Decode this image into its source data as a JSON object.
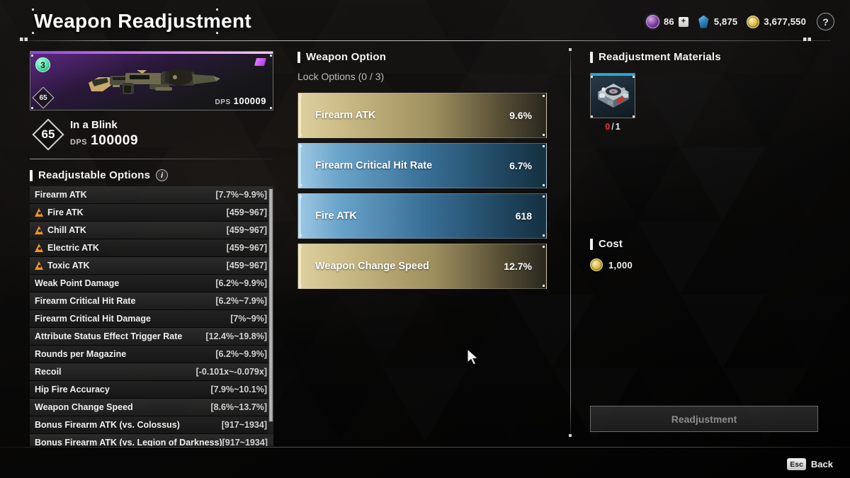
{
  "header": {
    "title": "Weapon Readjustment",
    "currencies": [
      {
        "icon": "orb-icon",
        "value": "86",
        "has_plus": true,
        "plus_label": "+"
      },
      {
        "icon": "gem-icon",
        "value": "5,875",
        "has_plus": false
      },
      {
        "icon": "gold-coin-icon",
        "value": "3,677,550",
        "has_plus": false
      }
    ],
    "help_label": "?"
  },
  "weapon": {
    "rank_badge": "3",
    "card_level": "65",
    "card_dps_label": "DPS",
    "card_dps_value": "100009",
    "level": "65",
    "name": "In a Blink",
    "dps_label": "DPS",
    "dps_value": "100009"
  },
  "readjustable": {
    "heading": "Readjustable Options",
    "info_label": "i",
    "rows": [
      {
        "name": "Firearm ATK",
        "range": "[7.7%~9.9%]",
        "warn": false
      },
      {
        "name": "Fire ATK",
        "range": "[459~967]",
        "warn": true
      },
      {
        "name": "Chill ATK",
        "range": "[459~967]",
        "warn": true
      },
      {
        "name": "Electric ATK",
        "range": "[459~967]",
        "warn": true
      },
      {
        "name": "Toxic ATK",
        "range": "[459~967]",
        "warn": true
      },
      {
        "name": "Weak Point Damage",
        "range": "[6.2%~9.9%]",
        "warn": false
      },
      {
        "name": "Firearm Critical Hit Rate",
        "range": "[6.2%~7.9%]",
        "warn": false
      },
      {
        "name": "Firearm Critical Hit Damage",
        "range": "[7%~9%]",
        "warn": false
      },
      {
        "name": "Attribute Status Effect Trigger Rate",
        "range": "[12.4%~19.8%]",
        "warn": false
      },
      {
        "name": "Rounds per Magazine",
        "range": "[6.2%~9.9%]",
        "warn": false
      },
      {
        "name": "Recoil",
        "range": "[-0.101x~-0.079x]",
        "warn": false
      },
      {
        "name": "Hip Fire Accuracy",
        "range": "[7.9%~10.1%]",
        "warn": false
      },
      {
        "name": "Weapon Change Speed",
        "range": "[8.6%~13.7%]",
        "warn": false
      },
      {
        "name": "Bonus Firearm ATK (vs. Colossus)",
        "range": "[917~1934]",
        "warn": false
      },
      {
        "name": "Bonus Firearm ATK (vs. Legion of Darkness)",
        "range": "[917~1934]",
        "warn": false
      }
    ]
  },
  "weapon_option": {
    "heading": "Weapon Option",
    "lock_options": "Lock Options (0 / 3)",
    "bars": [
      {
        "label": "Firearm ATK",
        "value": "9.6%",
        "style": "gold"
      },
      {
        "label": "Firearm Critical Hit Rate",
        "value": "6.7%",
        "style": "blue"
      },
      {
        "label": "Fire ATK",
        "value": "618",
        "style": "blue"
      },
      {
        "label": "Weapon Change Speed",
        "value": "12.7%",
        "style": "gold"
      }
    ]
  },
  "materials": {
    "heading": "Readjustment Materials",
    "slots": [
      {
        "icon": "module-part-icon",
        "have": "0",
        "separator": "/",
        "need": "1"
      }
    ]
  },
  "cost": {
    "heading": "Cost",
    "icon": "gold-coin-icon",
    "value": "1,000"
  },
  "actions": {
    "readjustment_label": "Readjustment",
    "readjustment_enabled": false
  },
  "footer": {
    "key": "Esc",
    "label": "Back"
  },
  "colors": {
    "accent_gold": "#cbbb86",
    "accent_blue": "#6ba5cb",
    "rarity_purple": "#c06ff0",
    "warn_orange": "#f0922b",
    "shortage_red": "#e03b3b",
    "material_top": "#2aa9df"
  }
}
